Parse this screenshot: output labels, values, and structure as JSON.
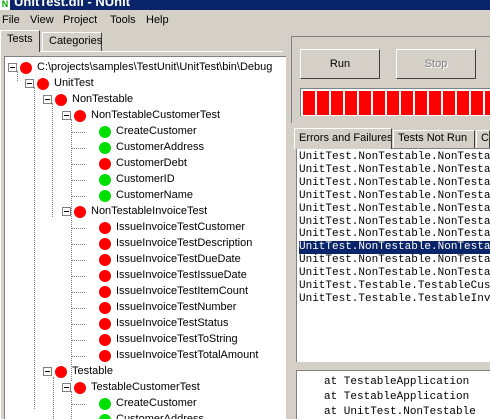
{
  "window": {
    "title": "UnitTest.dll - NUnit",
    "app_icon": "nunit-icon"
  },
  "menu": [
    "File",
    "View",
    "Project",
    "Tools",
    "Help"
  ],
  "left_tabs": [
    "Tests",
    "Categories"
  ],
  "tree": [
    {
      "label": "C:\\projects\\samples\\TestUnit\\UnitTest\\bin\\Debug",
      "status": "red"
    },
    {
      "label": "UnitTest",
      "status": "red"
    },
    {
      "label": "NonTestable",
      "status": "red"
    },
    {
      "label": "NonTestableCustomerTest",
      "status": "red"
    },
    {
      "label": "CreateCustomer",
      "status": "green"
    },
    {
      "label": "CustomerAddress",
      "status": "green"
    },
    {
      "label": "CustomerDebt",
      "status": "red"
    },
    {
      "label": "CustomerID",
      "status": "green"
    },
    {
      "label": "CustomerName",
      "status": "green"
    },
    {
      "label": "NonTestableInvoiceTest",
      "status": "red"
    },
    {
      "label": "IssueInvoiceTestCustomer",
      "status": "red"
    },
    {
      "label": "IssueInvoiceTestDescription",
      "status": "red"
    },
    {
      "label": "IssueInvoiceTestDueDate",
      "status": "red"
    },
    {
      "label": "IssueInvoiceTestIssueDate",
      "status": "red"
    },
    {
      "label": "IssueInvoiceTestItemCount",
      "status": "red"
    },
    {
      "label": "IssueInvoiceTestNumber",
      "status": "red"
    },
    {
      "label": "IssueInvoiceTestStatus",
      "status": "red"
    },
    {
      "label": "IssueInvoiceTestToString",
      "status": "red"
    },
    {
      "label": "IssueInvoiceTestTotalAmount",
      "status": "red"
    },
    {
      "label": "Testable",
      "status": "red"
    },
    {
      "label": "TestableCustomerTest",
      "status": "red"
    },
    {
      "label": "CreateCustomer",
      "status": "green"
    },
    {
      "label": "CustomerAddress",
      "status": "green"
    }
  ],
  "buttons": {
    "run": "Run",
    "stop": "Stop"
  },
  "progress": {
    "status": "failed",
    "color": "#ff0000"
  },
  "result_tabs": [
    "Errors and Failures",
    "Tests Not Run",
    "Console"
  ],
  "results": [
    "UnitTest.NonTestable.NonTestable",
    "UnitTest.NonTestable.NonTestable",
    "UnitTest.NonTestable.NonTestable",
    "UnitTest.NonTestable.NonTestable",
    "UnitTest.NonTestable.NonTestable",
    "UnitTest.NonTestable.NonTestable",
    "UnitTest.NonTestable.NonTestable",
    "UnitTest.NonTestable.NonTestable",
    "UnitTest.NonTestable.NonTestable",
    "UnitTest.NonTestable.NonTestable",
    "UnitTest.Testable.TestableCustomer",
    "UnitTest.Testable.TestableInvoice"
  ],
  "selected_result": 7,
  "stack_trace": [
    "at TestableApplication",
    "at TestableApplication",
    "at UnitTest.NonTestable"
  ]
}
